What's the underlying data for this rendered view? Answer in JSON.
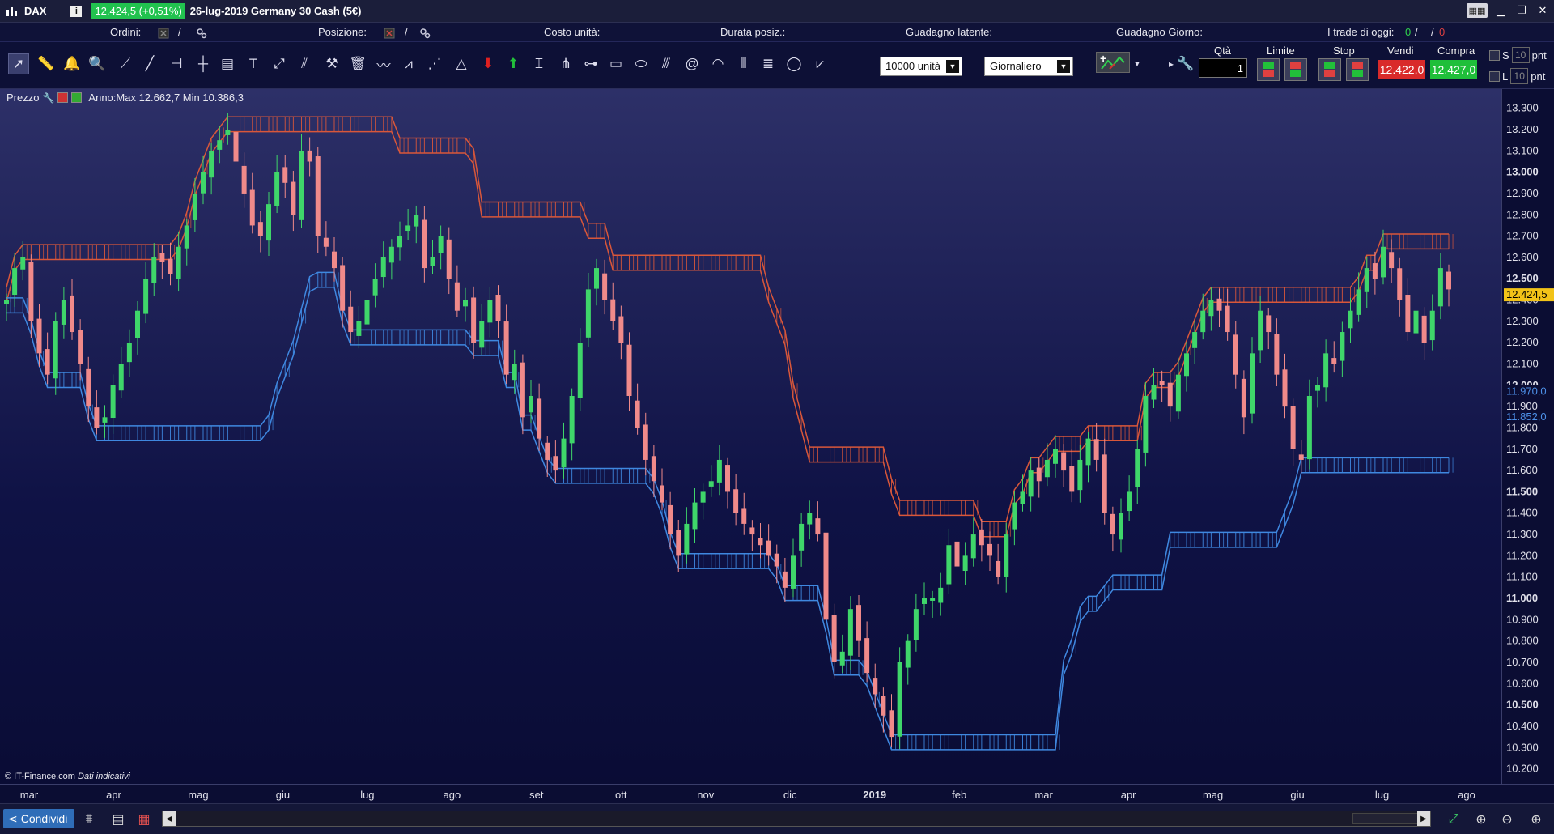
{
  "titlebar": {
    "symbol": "DAX",
    "info": "i",
    "price_change": "12.424,5 (+0,51%)",
    "title": "26-lug-2019 Germany 30 Cash (5€)"
  },
  "infobar": {
    "orders_label": "Ordini:",
    "orders_sep": "/",
    "position_label": "Posizione:",
    "position_sep": "/",
    "unit_cost_label": "Costo unità:",
    "duration_label": "Durata posiz.:",
    "latent_gain_label": "Guadagno latente:",
    "day_gain_label": "Guadagno Giorno:",
    "trades_today_label": "I trade di oggi:",
    "trades_green": "0",
    "trades_sep1": "/",
    "trades_sep2": "/",
    "trades_red": "0"
  },
  "toolbar": {
    "quantity_select": "10000 unità",
    "timeframe_select": "Giornaliero",
    "qty_label": "Qtà",
    "qty_value": "1",
    "limit_label": "Limite",
    "stop_label": "Stop",
    "sell_label": "Vendi",
    "sell_price": "12.422,0",
    "buy_label": "Compra",
    "buy_price": "12.427,0",
    "s_label": "S",
    "l_label": "L",
    "s_value": "10",
    "l_value": "10",
    "pnt": "pnt"
  },
  "chart": {
    "price_label": "Prezzo",
    "range_text": "Anno:Max 12.662,7 Min 10.386,3",
    "copyright": "© IT-Finance.com",
    "indicative": "Dati indicativi",
    "current_price_tag": "12.424,5",
    "kijun_tag": "11.970,0",
    "kijun2_tag": "11.852,0"
  },
  "chart_data": {
    "type": "candlestick",
    "title": "",
    "y_axis": {
      "ticks": [
        13300,
        13200,
        13100,
        13000,
        12900,
        12800,
        12700,
        12600,
        12500,
        12400,
        12300,
        12200,
        12100,
        12000,
        11900,
        11800,
        11700,
        11600,
        11500,
        11400,
        11300,
        11200,
        11100,
        11000,
        10900,
        10800,
        10700,
        10600,
        10500,
        10400,
        10300,
        10200
      ],
      "labels": [
        "13.300",
        "13.200",
        "13.100",
        "13.000",
        "12.900",
        "12.800",
        "12.700",
        "12.600",
        "12.500",
        "12.400",
        "12.300",
        "12.200",
        "12.100",
        "12.000",
        "11.900",
        "11.800",
        "11.700",
        "11.600",
        "11.500",
        "11.400",
        "11.300",
        "11.200",
        "11.100",
        "11.000",
        "10.900",
        "10.800",
        "10.700",
        "10.600",
        "10.500",
        "10.400",
        "10.300",
        "10.200"
      ],
      "bold": [
        13000,
        12500,
        12000,
        11500,
        11000,
        10500
      ],
      "ylim": [
        10130,
        13390
      ]
    },
    "x_axis": {
      "labels": [
        "mar",
        "apr",
        "mag",
        "giu",
        "lug",
        "ago",
        "set",
        "ott",
        "nov",
        "dic",
        "2019",
        "feb",
        "mar",
        "apr",
        "mag",
        "giu",
        "lug",
        "ago"
      ]
    },
    "close_series": [
      12400,
      12550,
      12600,
      12300,
      12150,
      12050,
      12300,
      12400,
      12250,
      12100,
      11900,
      11800,
      11850,
      12000,
      12100,
      12200,
      12350,
      12500,
      12600,
      12580,
      12520,
      12650,
      12750,
      12900,
      13000,
      13100,
      13150,
      13200,
      13050,
      12900,
      12750,
      12700,
      12850,
      13000,
      12950,
      12800,
      13100,
      13050,
      12700,
      12650,
      12550,
      12350,
      12250,
      12300,
      12400,
      12500,
      12600,
      12650,
      12700,
      12750,
      12800,
      12550,
      12600,
      12700,
      12500,
      12350,
      12400,
      12200,
      12300,
      12400,
      12300,
      12050,
      12100,
      11850,
      11950,
      11750,
      11650,
      11600,
      11750,
      11950,
      12200,
      12450,
      12550,
      12400,
      12300,
      12200,
      11950,
      11800,
      11650,
      11550,
      11450,
      11300,
      11200,
      11350,
      11450,
      11500,
      11550,
      11650,
      11500,
      11400,
      11350,
      11300,
      11250,
      11200,
      11150,
      11050,
      11200,
      11350,
      11400,
      11300,
      10900,
      10700,
      10750,
      10950,
      10800,
      10650,
      10550,
      10450,
      10350,
      10700,
      10800,
      10950,
      11000,
      11000,
      11050,
      11250,
      11150,
      11200,
      11300,
      11250,
      11200,
      11100,
      11300,
      11450,
      11500,
      11600,
      11550,
      11650,
      11700,
      11600,
      11500,
      11650,
      11750,
      11650,
      11400,
      11300,
      11400,
      11500,
      11700,
      11950,
      12000,
      12000,
      11900,
      12050,
      12150,
      12250,
      12350,
      12400,
      12350,
      12250,
      12050,
      11850,
      12150,
      12350,
      12250,
      12050,
      11900,
      11700,
      11650,
      11950,
      12000,
      12150,
      12100,
      12250,
      12350,
      12450,
      12550,
      12500,
      12650,
      12550,
      12400,
      12250,
      12350,
      12200,
      12350,
      12550,
      12450
    ],
    "kijun_upper_color": "#d9573a",
    "kijun_lower_color": "#3f88e0",
    "up_candle_color": "#3fd66a",
    "down_candle_color": "#f08a8a"
  },
  "bottom": {
    "share_label": "Condividi"
  }
}
